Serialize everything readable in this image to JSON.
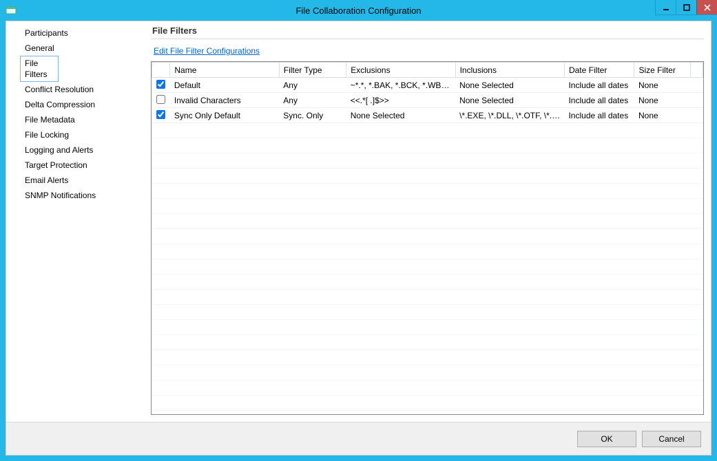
{
  "window": {
    "title": "File Collaboration Configuration"
  },
  "sidebar": {
    "items": [
      {
        "label": "Participants"
      },
      {
        "label": "General"
      },
      {
        "label": "File Filters",
        "selected": true
      },
      {
        "label": "Conflict Resolution"
      },
      {
        "label": "Delta Compression"
      },
      {
        "label": "File Metadata"
      },
      {
        "label": "File Locking"
      },
      {
        "label": "Logging and Alerts"
      },
      {
        "label": "Target Protection"
      },
      {
        "label": "Email Alerts"
      },
      {
        "label": "SNMP Notifications"
      }
    ]
  },
  "main": {
    "title": "File Filters",
    "link_label": "Edit File Filter Configurations",
    "columns": {
      "name": "Name",
      "filter_type": "Filter Type",
      "exclusions": "Exclusions",
      "inclusions": "Inclusions",
      "date_filter": "Date Filter",
      "size_filter": "Size Filter"
    },
    "rows": [
      {
        "checked": true,
        "name": "Default",
        "filter_type": "Any",
        "exclusions": "~*.*, *.BAK, *.BCK, *.WBK, ...",
        "inclusions": "None Selected",
        "date_filter": "Include all dates",
        "size_filter": "None"
      },
      {
        "checked": false,
        "name": "Invalid Characters",
        "filter_type": "Any",
        "exclusions": "<<.*[ .]$>>",
        "inclusions": "None Selected",
        "date_filter": "Include all dates",
        "size_filter": "None"
      },
      {
        "checked": true,
        "name": "Sync Only Default",
        "filter_type": "Sync. Only",
        "exclusions": "None Selected",
        "inclusions": "\\*.EXE, \\*.DLL, \\*.OTF, \\*.T...",
        "date_filter": "Include all dates",
        "size_filter": "None"
      }
    ]
  },
  "footer": {
    "ok": "OK",
    "cancel": "Cancel"
  }
}
